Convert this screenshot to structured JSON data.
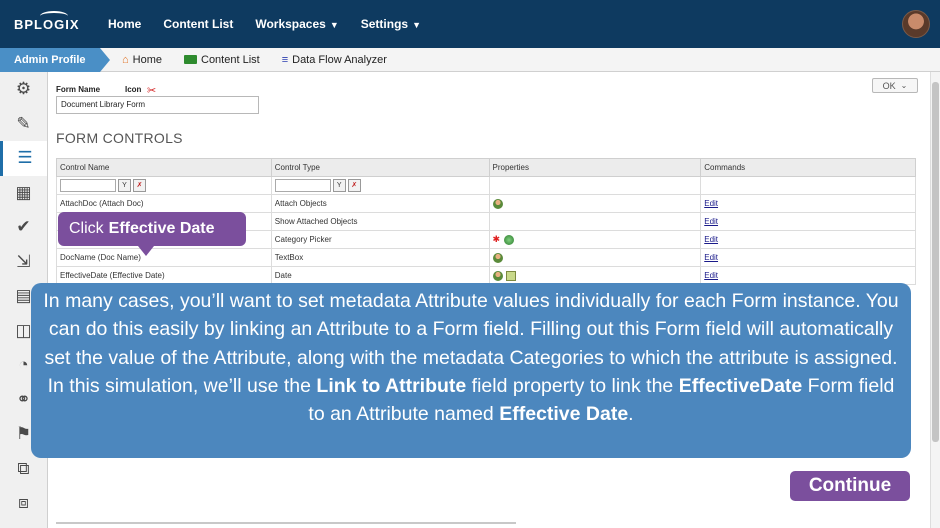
{
  "topnav": {
    "logo": "BPLOGIX",
    "items": [
      {
        "label": "Home",
        "has_caret": false
      },
      {
        "label": "Content List",
        "has_caret": false
      },
      {
        "label": "Workspaces",
        "has_caret": true
      },
      {
        "label": "Settings",
        "has_caret": true
      }
    ],
    "caret_glyph": "▼"
  },
  "crumbbar": {
    "admin_profile": "Admin Profile",
    "crumbs": [
      {
        "label": "Home",
        "icon": "home-icon"
      },
      {
        "label": "Content List",
        "icon": "folder-icon"
      },
      {
        "label": "Data Flow Analyzer",
        "icon": "database-icon"
      }
    ]
  },
  "sidebar": {
    "icons": [
      "gears-icon",
      "edit-icon",
      "list-icon",
      "table-icon",
      "check-icon",
      "download-icon",
      "document-icon",
      "database-icon",
      "gauge-icon",
      "link-icon",
      "flag-icon",
      "copy-icon",
      "clone-icon"
    ],
    "active_index": 2
  },
  "form": {
    "form_name_label": "Form Name",
    "icon_label": "Icon",
    "form_name_value": "Document Library Form",
    "ok_button": "OK"
  },
  "section": {
    "title": "FORM CONTROLS"
  },
  "grid": {
    "columns": [
      "Control Name",
      "Control Type",
      "Properties",
      "Commands"
    ],
    "rows": [
      {
        "name": "AttachDoc (Attach Doc)",
        "type": "Attach Objects",
        "props": [
          "user"
        ],
        "command": "Edit"
      },
      {
        "name": "",
        "type": "Show Attached Objects",
        "props": [],
        "command": "Edit"
      },
      {
        "name": "",
        "type": "Category Picker",
        "props": [
          "required",
          "globe"
        ],
        "command": "Edit"
      },
      {
        "name": "DocName (Doc Name)",
        "type": "TextBox",
        "props": [
          "user"
        ],
        "command": "Edit"
      },
      {
        "name": "EffectiveDate (Effective Date)",
        "type": "Date",
        "props": [
          "user",
          "edit"
        ],
        "command": "Edit"
      }
    ]
  },
  "callout": {
    "prefix": "Click",
    "target": "Effective Date"
  },
  "info": {
    "t1": "In many cases, you’ll want to set metadata Attribute values individually for each Form instance. You can do this easily by linking an Attribute to a Form field. Filling out this Form field will automatically set the value of the Attribute, along with the metadata Categories to which the attribute is assigned. In this simulation, we’ll use the ",
    "b1": "Link to Attribute",
    "t2": " field property to link the ",
    "b2": "EffectiveDate",
    "t3": " Form field to an Attribute named ",
    "b3": "Effective Date",
    "t4": "."
  },
  "continue_button": "Continue",
  "colors": {
    "nav_bg": "#0e3a60",
    "admin_tab": "#4a8fc6",
    "callout": "#7b4f9d",
    "info_panel": "#4c87be"
  }
}
